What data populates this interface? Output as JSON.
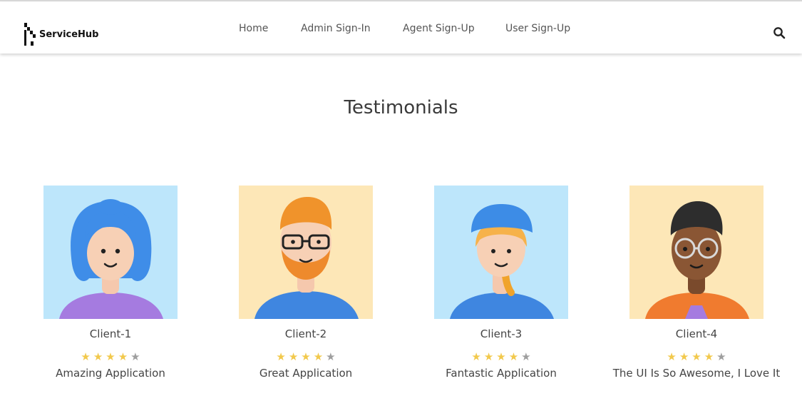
{
  "brand": {
    "name": "ServiceHub"
  },
  "nav": {
    "links": [
      "Home",
      "Admin Sign-In",
      "Agent Sign-Up",
      "User Sign-Up"
    ]
  },
  "icons": {
    "search": "search-icon"
  },
  "page": {
    "title": "Testimonials"
  },
  "colors": {
    "star_filled": "#f2c94c",
    "star_empty": "#9e9e9e",
    "bg_blue": "#bde6fb",
    "bg_yellow": "#fde7b7"
  },
  "testimonials": [
    {
      "name": "Client-1",
      "rating": 4,
      "max_rating": 5,
      "text": "Amazing Application"
    },
    {
      "name": "Client-2",
      "rating": 4,
      "max_rating": 5,
      "text": "Great Application"
    },
    {
      "name": "Client-3",
      "rating": 4,
      "max_rating": 5,
      "text": "Fantastic Application"
    },
    {
      "name": "Client-4",
      "rating": 4,
      "max_rating": 5,
      "text": "The UI Is So Awesome, I Love It"
    }
  ]
}
